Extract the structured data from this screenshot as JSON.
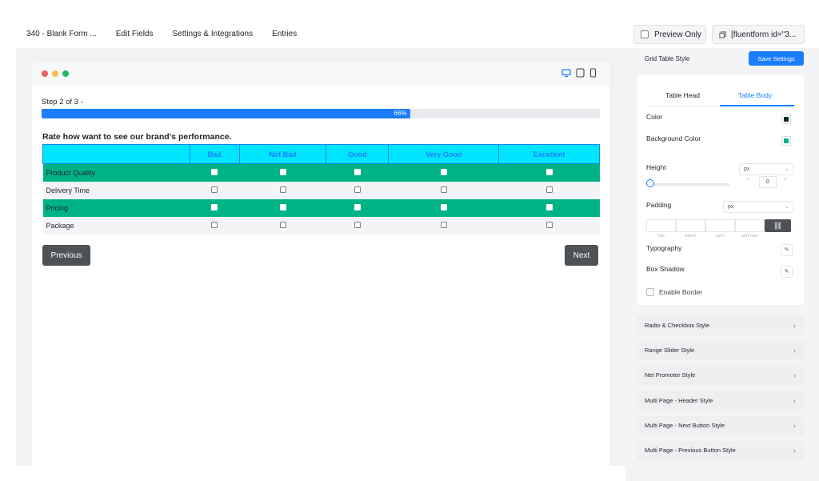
{
  "topbar": {
    "form_title": "340 - Blank Form ...",
    "nav": [
      "Edit Fields",
      "Settings & Integrations",
      "Entries"
    ],
    "preview_only_label": "Preview Only",
    "shortcode_label": "[fluentform id=\"3..."
  },
  "window": {
    "dots": [
      "#ee5d5d",
      "#f4bd4f",
      "#1fb764"
    ],
    "devices": [
      "desktop-icon",
      "tablet-icon",
      "mobile-icon"
    ]
  },
  "form": {
    "step_text": "Step 2 of 3 -",
    "progress_percent": 66,
    "progress_label": "66%",
    "question": "Rate how want to see our brand's performance.",
    "columns": [
      "",
      "Bad",
      "Not Bad",
      "Good",
      "Very Good",
      "Excellent"
    ],
    "rows": [
      "Product Quality",
      "Delivery Time",
      "Pricing",
      "Package"
    ],
    "previous_label": "Previous",
    "next_label": "Next"
  },
  "panel": {
    "title": "Grid Table Style",
    "save_label": "Save Settings",
    "tabs": [
      "Table Head",
      "Table Body"
    ],
    "active_tab": "Table Body",
    "color_label": "Color",
    "color_value": "#0b2a1f",
    "background_color_label": "Background Color",
    "background_color_value": "#00b386",
    "height_label": "Height",
    "height_unit": "px",
    "height_value": "0",
    "stepper_minus": "−",
    "stepper_plus": "+",
    "padding_label": "Padding",
    "padding_unit": "px",
    "padding_sides": [
      "TOP",
      "RIGHT",
      "LEFT",
      "BOTTOM"
    ],
    "typography_label": "Typography",
    "box_shadow_label": "Box Shadow",
    "enable_border_label": "Enable Border",
    "accordion": [
      "Radio & Checkbox Style",
      "Range Slider Style",
      "Net Promoter Style",
      "Multi Page - Header Style",
      "Multi Page - Next Button Style",
      "Multi Page - Previous Button Style"
    ]
  },
  "colors": {
    "accent": "#1a7efb",
    "table_head_bg": "#00e5ff",
    "odd_row_bg": "#00b386",
    "button_dark": "#4e5257"
  }
}
